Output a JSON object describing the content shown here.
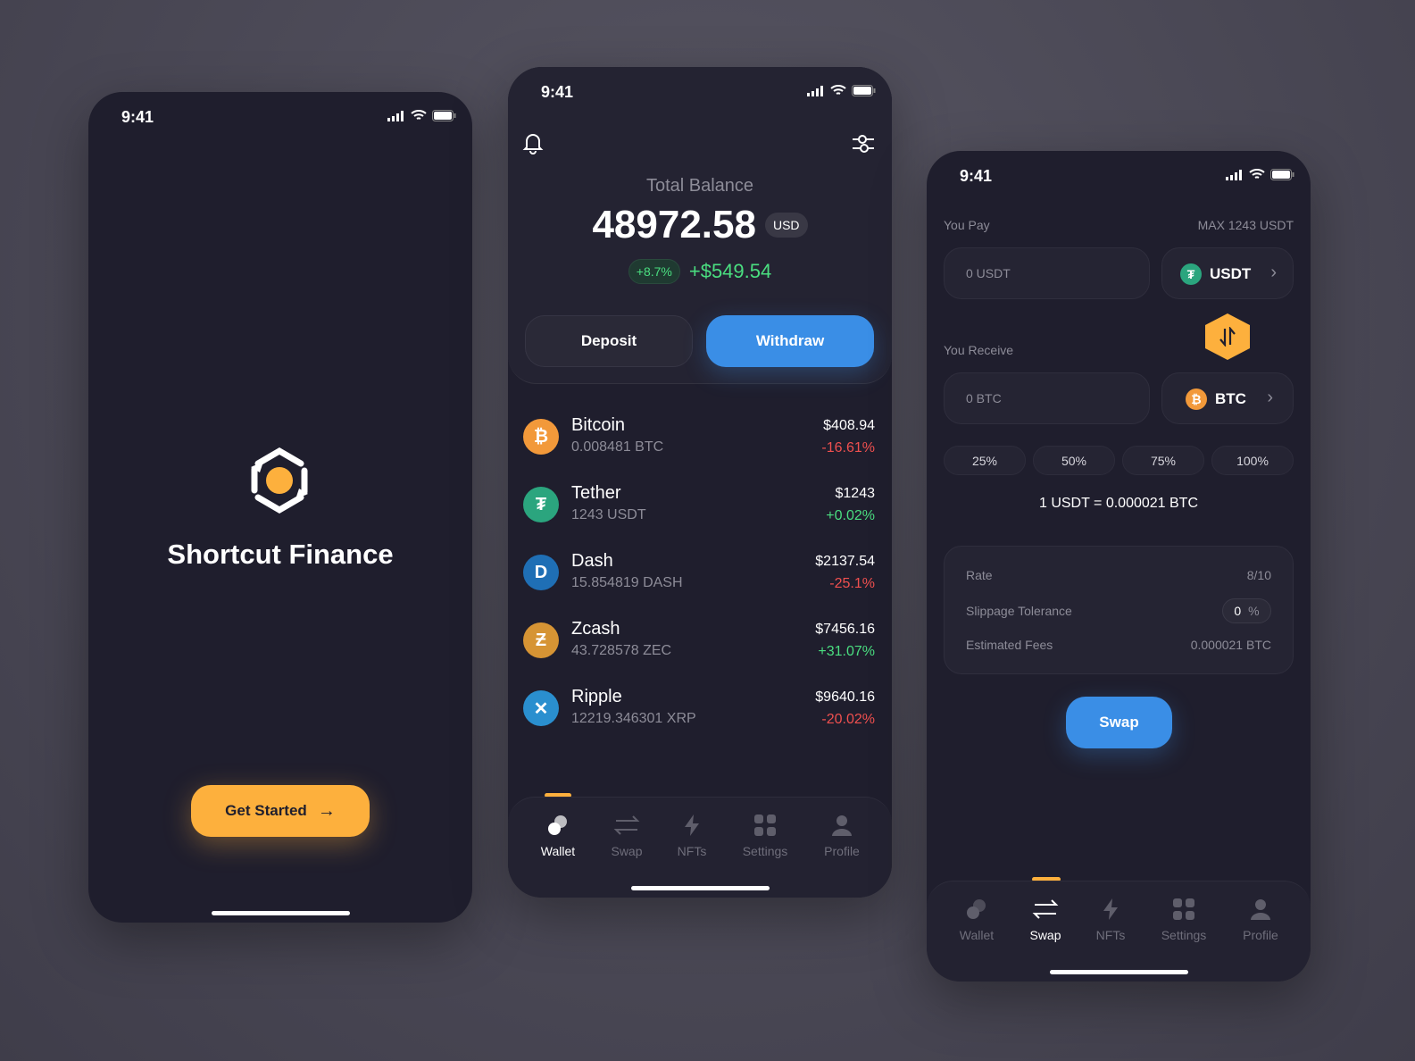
{
  "colors": {
    "accent": "#fdb03d",
    "primary": "#3a8ee6",
    "positive": "#4ade80",
    "negative": "#f0504f",
    "background": "#1f1e2d"
  },
  "status_time": "9:41",
  "splash": {
    "title": "Shortcut Finance",
    "cta": "Get Started",
    "cta_icon": "arrow-right-icon"
  },
  "wallet": {
    "balance_label": "Total Balance",
    "balance": "48972.58",
    "currency": "USD",
    "change_pct": "+8.7%",
    "change_amount": "+$549.54",
    "deposit": "Deposit",
    "withdraw": "Withdraw",
    "assets": [
      {
        "name": "Bitcoin",
        "amount": "0.008481 BTC",
        "value": "$408.94",
        "change": "-16.61%",
        "color": "#f2993a",
        "symbol": "₿"
      },
      {
        "name": "Tether",
        "amount": "1243 USDT",
        "value": "$1243",
        "change": "+0.02%",
        "color": "#2ba57e",
        "symbol": "₮"
      },
      {
        "name": "Dash",
        "amount": "15.854819 DASH",
        "value": "$2137.54",
        "change": "-25.1%",
        "color": "#1f6fb5",
        "symbol": "D"
      },
      {
        "name": "Zcash",
        "amount": "43.728578 ZEC",
        "value": "$7456.16",
        "change": "+31.07%",
        "color": "#d69434",
        "symbol": "Ƶ"
      },
      {
        "name": "Ripple",
        "amount": "12219.346301 XRP",
        "value": "$9640.16",
        "change": "-20.02%",
        "color": "#2a8fcf",
        "symbol": "✕"
      }
    ]
  },
  "tabs": [
    {
      "label": "Wallet",
      "icon": "wallet-icon"
    },
    {
      "label": "Swap",
      "icon": "swap-icon"
    },
    {
      "label": "NFTs",
      "icon": "bolt-icon"
    },
    {
      "label": "Settings",
      "icon": "grid-icon"
    },
    {
      "label": "Profile",
      "icon": "user-icon"
    }
  ],
  "swap": {
    "pay_label": "You Pay",
    "max": "MAX 1243 USDT",
    "pay_placeholder": "0 USDT",
    "pay_token": "USDT",
    "receive_label": "You Receive",
    "receive_placeholder": "0 BTC",
    "receive_token": "BTC",
    "percents": [
      "25%",
      "50%",
      "75%",
      "100%"
    ],
    "rate_line": "1 USDT = 0.000021 BTC",
    "rate_label": "Rate",
    "rate_value": "8/10",
    "slippage_label": "Slippage Tolerance",
    "slippage_value": "0",
    "slippage_unit": "%",
    "fees_label": "Estimated Fees",
    "fees_value": "0.000021 BTC",
    "swap_button": "Swap"
  }
}
